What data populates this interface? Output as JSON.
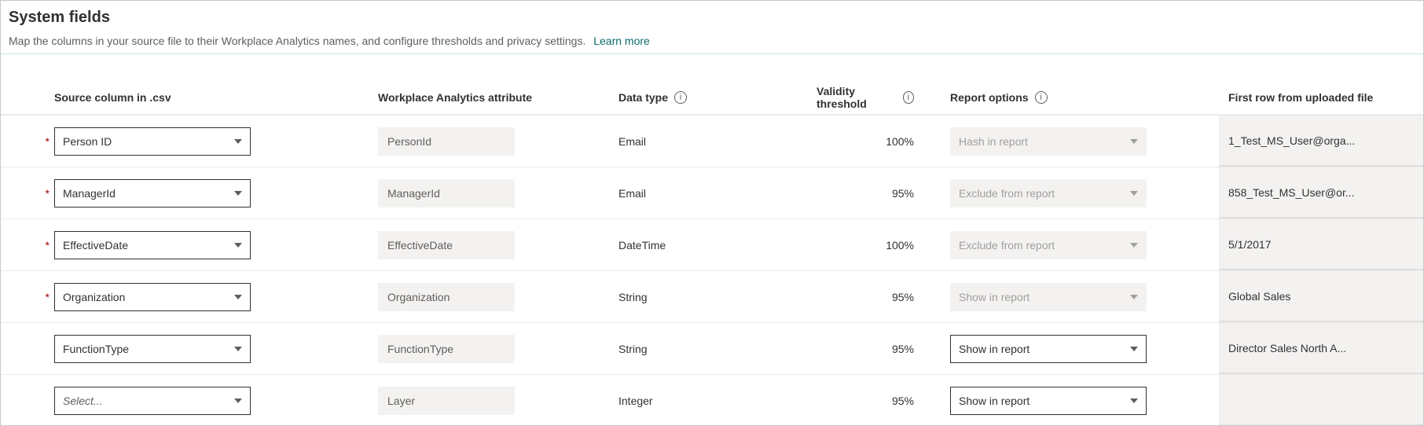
{
  "header": {
    "title": "System fields",
    "description": "Map the columns in your source file to their Workplace Analytics names, and configure thresholds and privacy settings.",
    "learn_more": "Learn more"
  },
  "columns": {
    "source": "Source column in .csv",
    "attribute": "Workplace Analytics attribute",
    "data_type": "Data type",
    "validity": "Validity threshold",
    "report": "Report options",
    "first_row": "First row from uploaded file"
  },
  "select_placeholder": "Select...",
  "rows": [
    {
      "required": true,
      "source": "Person ID",
      "attribute": "PersonId",
      "data_type": "Email",
      "validity": "100%",
      "report": "Hash in report",
      "report_enabled": false,
      "first_row": "1_Test_MS_User@orga..."
    },
    {
      "required": true,
      "source": "ManagerId",
      "attribute": "ManagerId",
      "data_type": "Email",
      "validity": "95%",
      "report": "Exclude from report",
      "report_enabled": false,
      "first_row": "858_Test_MS_User@or..."
    },
    {
      "required": true,
      "source": "EffectiveDate",
      "attribute": "EffectiveDate",
      "data_type": "DateTime",
      "validity": "100%",
      "report": "Exclude from report",
      "report_enabled": false,
      "first_row": "5/1/2017"
    },
    {
      "required": true,
      "source": "Organization",
      "attribute": "Organization",
      "data_type": "String",
      "validity": "95%",
      "report": "Show in report",
      "report_enabled": false,
      "first_row": "Global Sales"
    },
    {
      "required": false,
      "source": "FunctionType",
      "attribute": "FunctionType",
      "data_type": "String",
      "validity": "95%",
      "report": "Show in report",
      "report_enabled": true,
      "first_row": "Director Sales North A..."
    },
    {
      "required": false,
      "source": "",
      "attribute": "Layer",
      "data_type": "Integer",
      "validity": "95%",
      "report": "Show in report",
      "report_enabled": true,
      "first_row": ""
    }
  ]
}
